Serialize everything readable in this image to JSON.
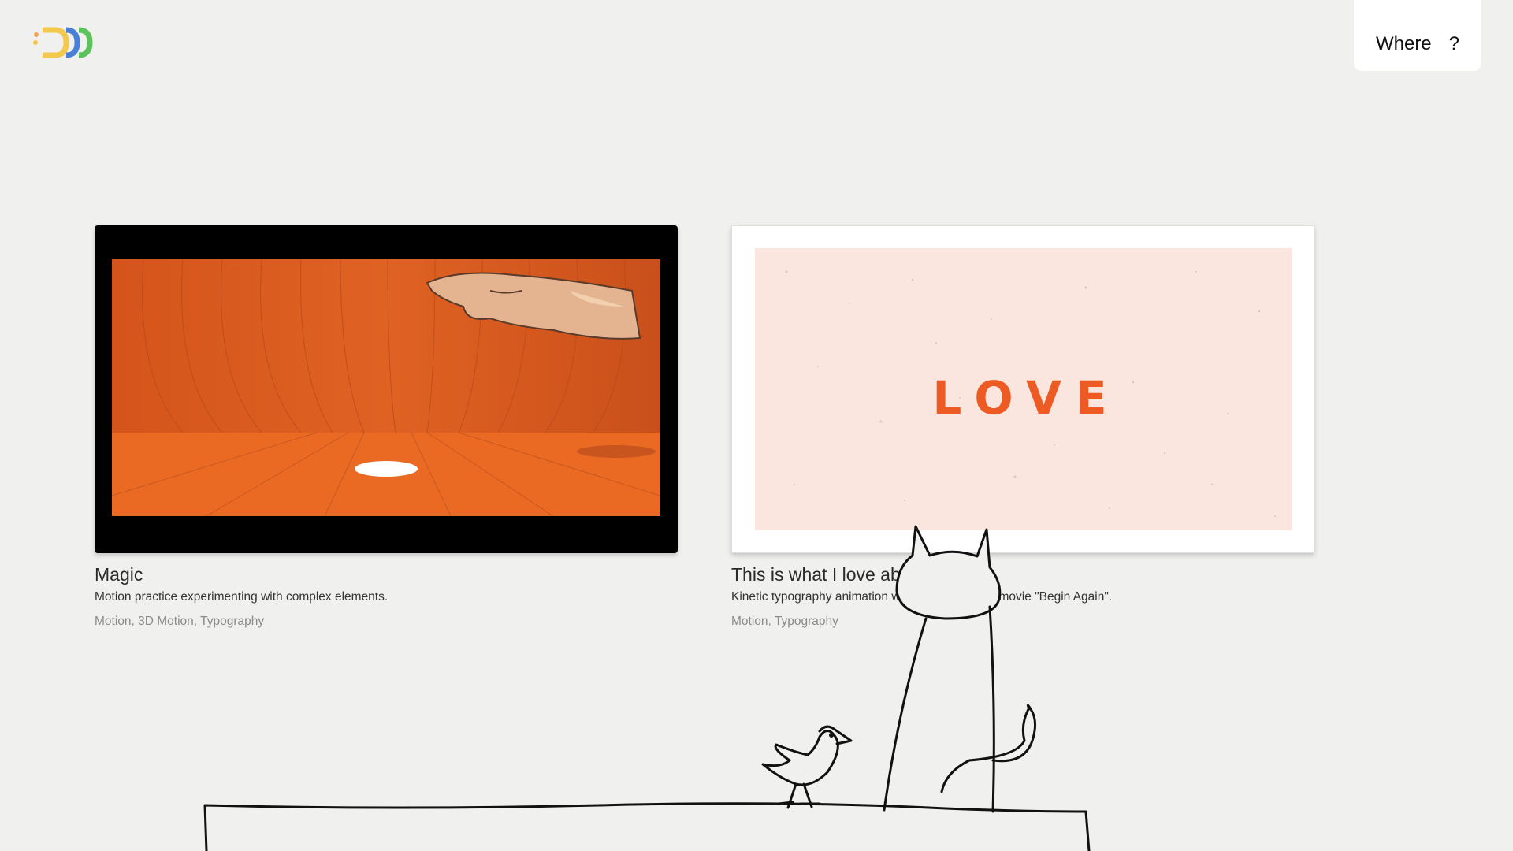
{
  "nav": {
    "where_label": "Where",
    "question_label": "?"
  },
  "projects": [
    {
      "title": "Magic",
      "description": "Motion practice experimenting with complex elements.",
      "tags": "Motion, 3D Motion, Typography"
    },
    {
      "title": "This is what I love about...",
      "description": "Kinetic typography animation with quote from the movie \"Begin Again\".",
      "tags": "Motion, Typography",
      "thumb_text": "LOVE"
    }
  ],
  "colors": {
    "background": "#f0f0ee",
    "accent_orange": "#e9641f",
    "love_text": "#ee5a24",
    "love_bg": "#fbe6df"
  }
}
